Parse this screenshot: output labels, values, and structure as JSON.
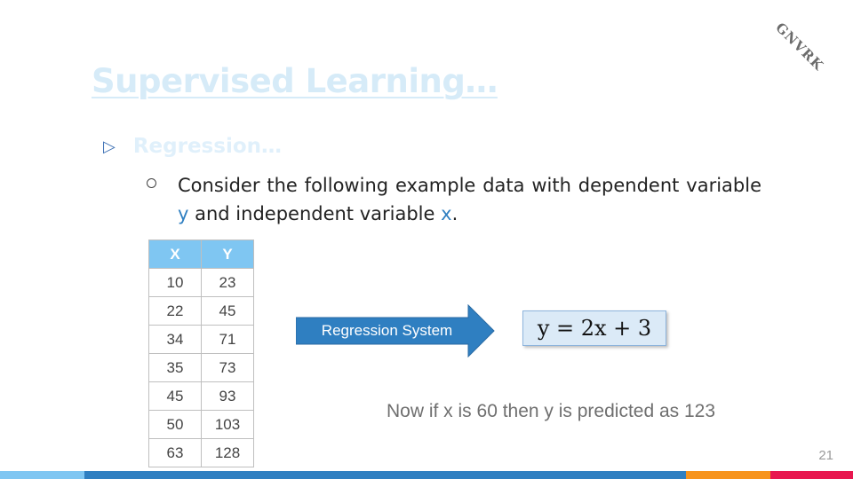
{
  "slide": {
    "watermark": "GNVRK",
    "title": "Supervised Learning…",
    "bullet_level1": "Regression…",
    "bullet_level2": {
      "line_start": "Consider the following example data with dependent variable ",
      "var_y": "y",
      "line_middle": " and independent variable ",
      "var_x": "x",
      "line_end": "."
    },
    "table": {
      "headers": [
        "X",
        "Y"
      ],
      "rows": [
        [
          "10",
          "23"
        ],
        [
          "22",
          "45"
        ],
        [
          "34",
          "71"
        ],
        [
          "35",
          "73"
        ],
        [
          "45",
          "93"
        ],
        [
          "50",
          "103"
        ],
        [
          "63",
          "128"
        ]
      ]
    },
    "arrow_label": "Regression System",
    "equation": "y = 2x + 3",
    "prediction": "Now if x is 60 then y is predicted as 123",
    "page_number": "21"
  },
  "colors": {
    "title": "#d6ebf8",
    "table_header_bg": "#7fc6f2",
    "arrow_fill": "#2f7fc1",
    "equation_bg": "#dbeaf7",
    "variable_blue": "#2f7fc1",
    "footer": [
      "#7fc6f2",
      "#2f7fc1",
      "#f7941d",
      "#e8174f"
    ]
  }
}
